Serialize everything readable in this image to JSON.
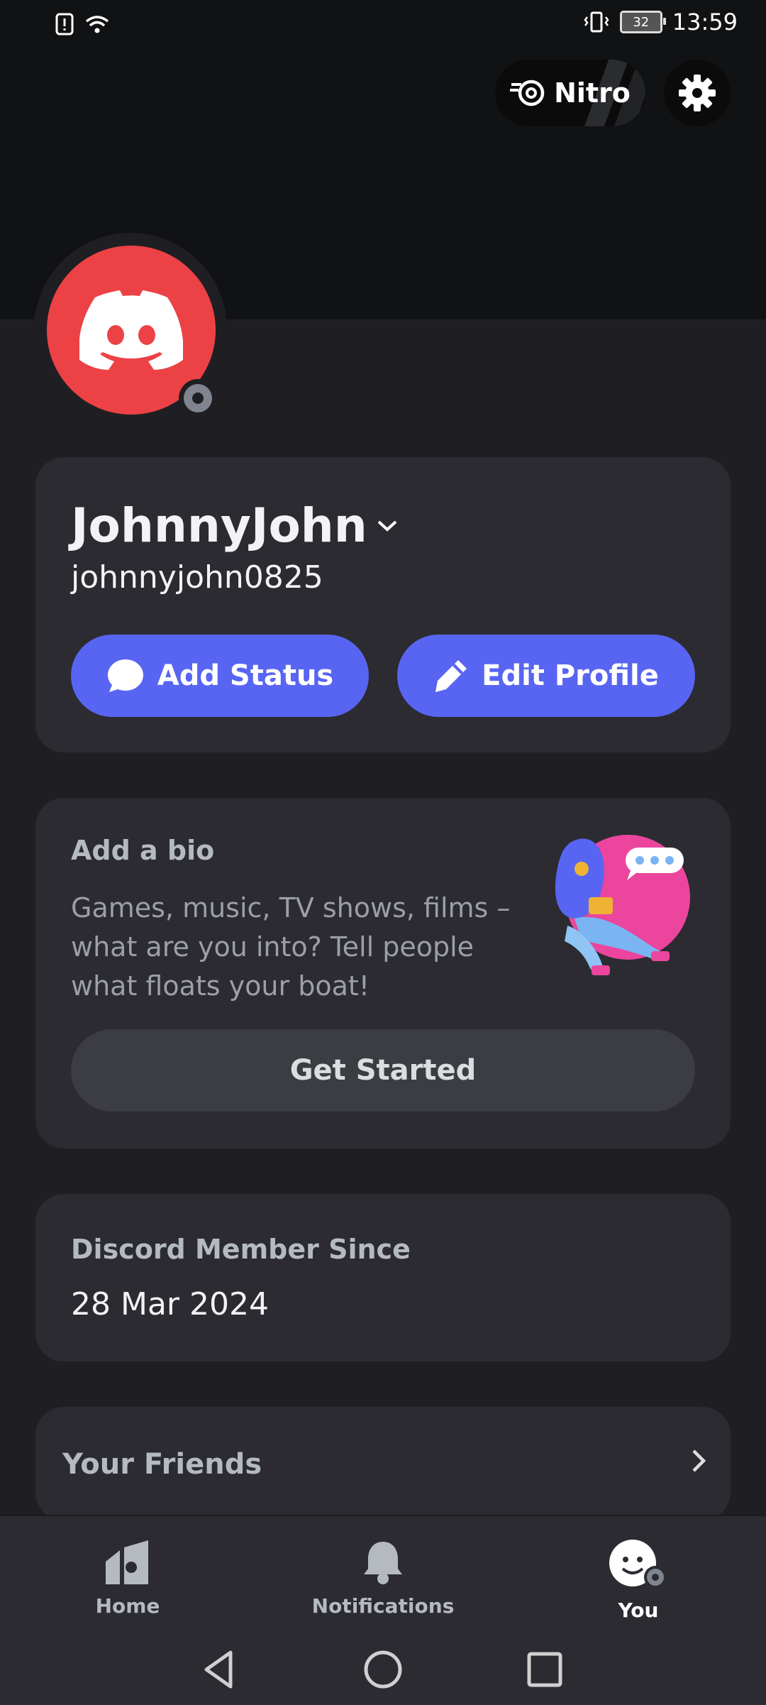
{
  "status_bar": {
    "time": "13:59",
    "battery": "32"
  },
  "header": {
    "nitro_label": "Nitro"
  },
  "profile": {
    "display_name": "JohnnyJohn",
    "username": "johnnyjohn0825",
    "add_status_label": "Add Status",
    "edit_profile_label": "Edit Profile"
  },
  "bio": {
    "title": "Add a bio",
    "text": "Games, music, TV shows, films – what are you into? Tell people what floats your boat!",
    "button_label": "Get Started"
  },
  "member": {
    "title": "Discord Member Since",
    "date": "28 Mar 2024"
  },
  "friends": {
    "label": "Your Friends"
  },
  "nav": {
    "home": "Home",
    "notifications": "Notifications",
    "you": "You"
  },
  "colors": {
    "accent": "#5865f2",
    "avatar": "#ed4245",
    "background": "#1f1f23",
    "card": "#2b2b31"
  }
}
